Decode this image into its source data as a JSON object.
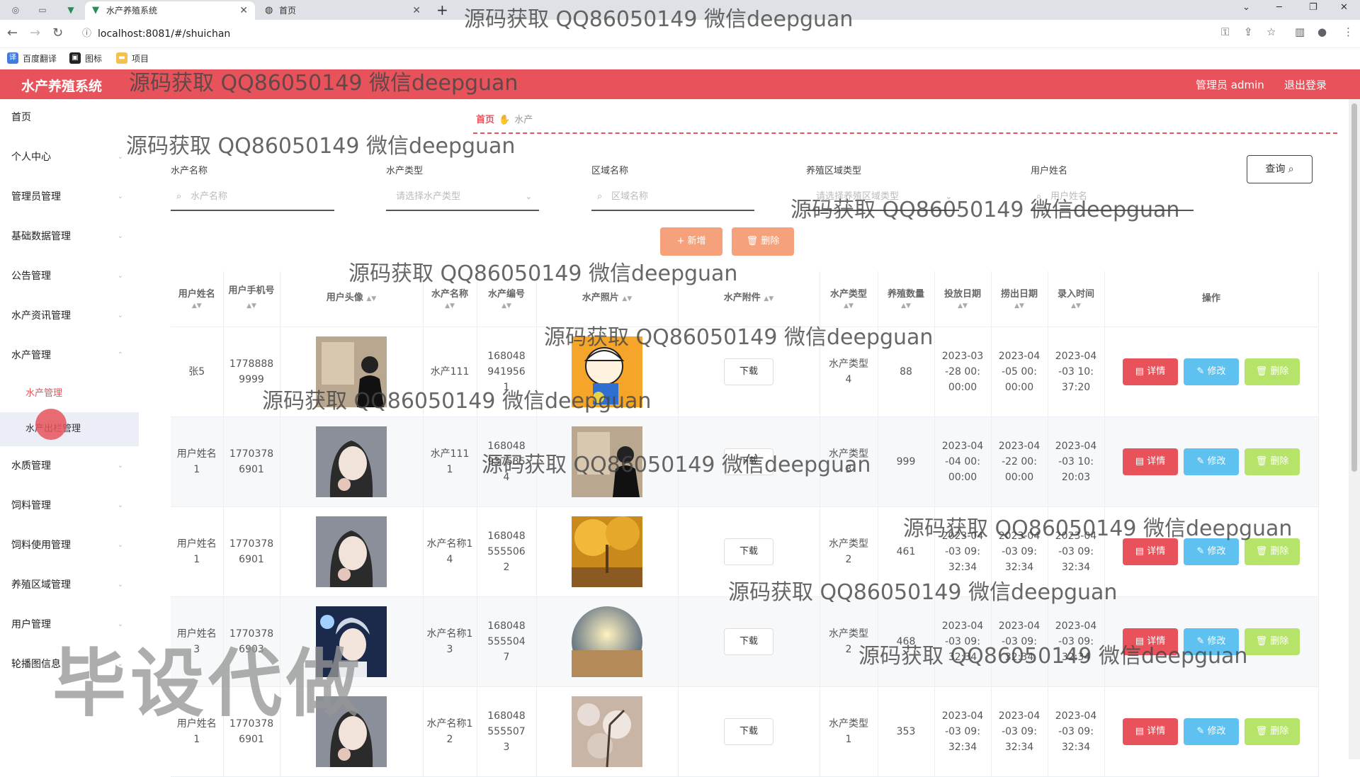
{
  "browser": {
    "tabs": [
      {
        "title": "水产养殖系统",
        "active": true
      },
      {
        "title": "首页",
        "active": false
      }
    ],
    "url": "localhost:8081/#/shuichan",
    "bookmarks": [
      "百度翻译",
      "图标",
      "项目"
    ]
  },
  "header": {
    "title": "水产养殖系统",
    "user": "管理员 admin",
    "logout": "退出登录"
  },
  "sidebar": {
    "items": [
      "首页",
      "个人中心",
      "管理员管理",
      "基础数据管理",
      "公告管理",
      "水产资讯管理",
      "水产管理",
      "水质管理",
      "饲料管理",
      "饲料使用管理",
      "养殖区域管理",
      "用户管理",
      "轮播图信息"
    ],
    "sub_items": [
      "水产管理",
      "水产出栏管理"
    ],
    "active_sub": "水产管理"
  },
  "breadcrumb": {
    "home": "首页",
    "current": "水产"
  },
  "filters": {
    "labels": [
      "水产名称",
      "水产类型",
      "区域名称",
      "养殖区域类型",
      "用户姓名"
    ],
    "placeholders": [
      "水产名称",
      "请选择水产类型",
      "区域名称",
      "请选择养殖区域类型",
      "用户姓名"
    ],
    "query_button": "查询"
  },
  "actions": {
    "add": "新增",
    "delete": "删除"
  },
  "table": {
    "headers": [
      "用户姓名",
      "用户手机号",
      "用户头像",
      "水产名称",
      "水产编号",
      "水产照片",
      "水产附件",
      "水产类型",
      "养殖数量",
      "投放日期",
      "捞出日期",
      "录入时间",
      "操作"
    ],
    "download_label": "下载",
    "op_labels": {
      "detail": "详情",
      "edit": "修改",
      "delete": "删除"
    },
    "rows": [
      {
        "name": "张5",
        "phone": "17788889999",
        "fish_name": "水产111",
        "fish_no": "1680489419561",
        "type": "水产类型4",
        "count": "88",
        "put_date": "2023-03-28 00:00:00",
        "out_date": "2023-04-05 00:00:00",
        "created": "2023-04-03 10:37:20"
      },
      {
        "name": "用户姓名1",
        "phone": "17703786901",
        "fish_name": "水产1111",
        "fish_no": "1680489375354",
        "type": "水产类型3",
        "count": "999",
        "put_date": "2023-04-04 00:00:00",
        "out_date": "2023-04-22 00:00:00",
        "created": "2023-04-03 10:20:03"
      },
      {
        "name": "用户姓名1",
        "phone": "17703786901",
        "fish_name": "水产名称14",
        "fish_no": "1680485555062",
        "type": "水产类型2",
        "count": "461",
        "put_date": "2023-04-03 09:32:34",
        "out_date": "2023-04-03 09:32:34",
        "created": "2023-04-03 09:32:34"
      },
      {
        "name": "用户姓名3",
        "phone": "17703786903",
        "fish_name": "水产名称13",
        "fish_no": "1680485555047",
        "type": "水产类型2",
        "count": "468",
        "put_date": "2023-04-03 09:32:34",
        "out_date": "2023-04-03 09:32:34",
        "created": "2023-04-03 09:32:34"
      },
      {
        "name": "用户姓名1",
        "phone": "17703786901",
        "fish_name": "水产名称12",
        "fish_no": "1680485555073",
        "type": "水产类型1",
        "count": "353",
        "put_date": "2023-04-03 09:32:34",
        "out_date": "2023-04-03 09:32:34",
        "created": "2023-04-03 09:32:34"
      }
    ]
  },
  "watermark": {
    "text": "源码获取 QQ86050149 微信deepguan",
    "big": "毕设代做"
  },
  "colors": {
    "primary": "#e8525a",
    "accent_orange": "#f5a27c",
    "edit_blue": "#5ec1f0",
    "delete_green": "#b6e36a"
  }
}
